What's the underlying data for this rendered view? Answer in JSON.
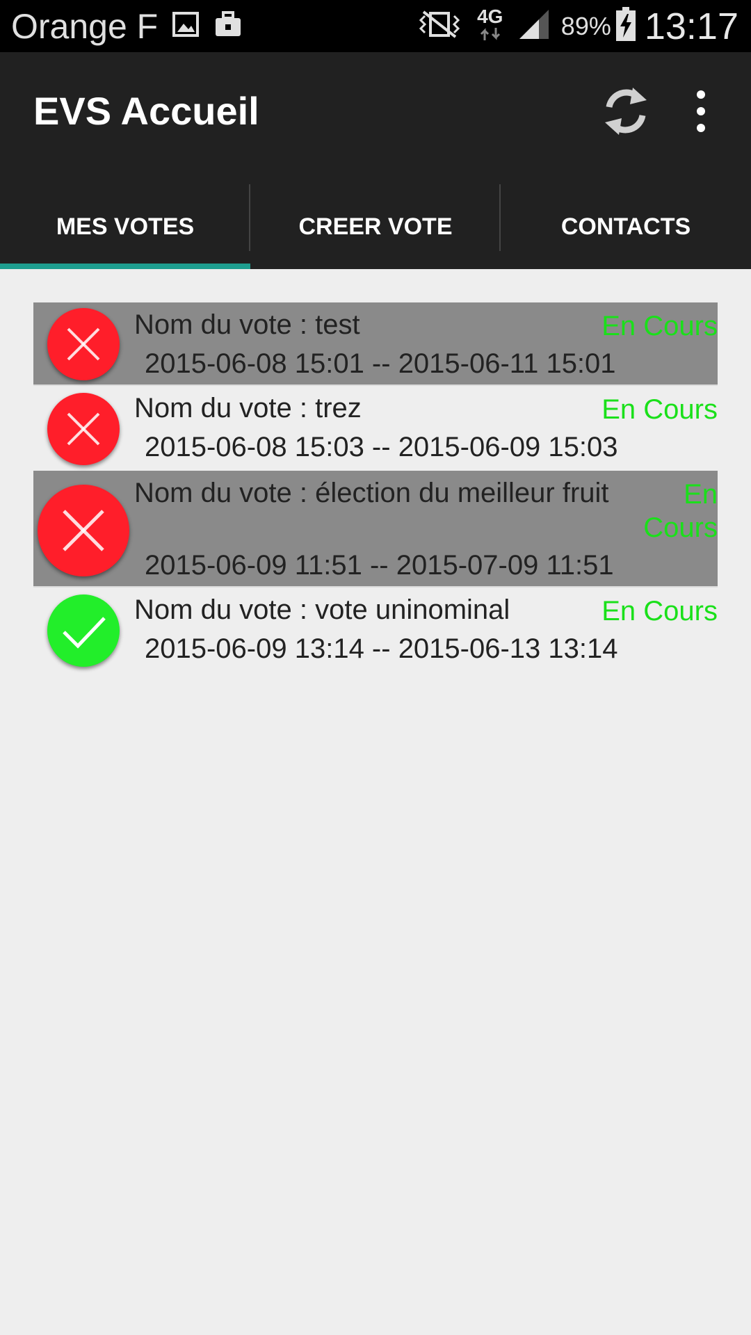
{
  "status_bar": {
    "carrier": "Orange F",
    "network": "4G",
    "battery": "89%",
    "time": "13:17",
    "icons": [
      "image-icon",
      "briefcase-icon",
      "vibrate-icon",
      "network-arrows-icon",
      "signal-icon",
      "battery-charging-icon"
    ]
  },
  "app_bar": {
    "title": "EVS Accueil",
    "actions": [
      "refresh-icon",
      "overflow-menu-icon"
    ]
  },
  "tabs": [
    {
      "label": "MES VOTES",
      "selected": true
    },
    {
      "label": "CREER VOTE",
      "selected": false
    },
    {
      "label": "CONTACTS",
      "selected": false
    }
  ],
  "colors": {
    "accent": "#1e9e8f",
    "status_active": "#1ae01a",
    "icon_closed": "#ff1e2a",
    "icon_voted": "#22ee2a"
  },
  "votes": [
    {
      "name": "Nom du vote :  test",
      "status": "En Cours",
      "dates": "2015-06-08 15:01 --  2015-06-11 15:01",
      "icon": "close-icon"
    },
    {
      "name": "Nom du vote :  trez",
      "status": "En Cours",
      "dates": "2015-06-08 15:03 --  2015-06-09 15:03",
      "icon": "close-icon"
    },
    {
      "name": "Nom du vote :  élection du meilleur fruit",
      "status": "En Cours",
      "dates": "2015-06-09 11:51 --  2015-07-09 11:51",
      "icon": "close-icon"
    },
    {
      "name": "Nom du vote :  vote uninominal",
      "status": "En Cours",
      "dates": "2015-06-09 13:14 --  2015-06-13 13:14",
      "icon": "check-icon"
    }
  ]
}
